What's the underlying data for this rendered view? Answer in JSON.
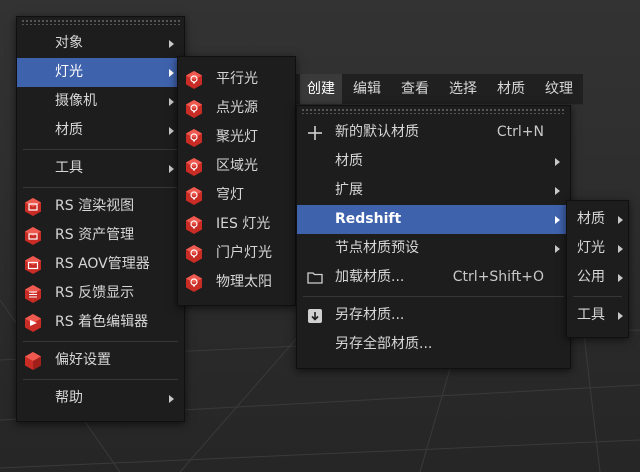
{
  "menubar": {
    "items": [
      "创建",
      "编辑",
      "查看",
      "选择",
      "材质",
      "纹理"
    ]
  },
  "main_menu": {
    "items": [
      {
        "label": "对象",
        "submenu": true
      },
      {
        "label": "灯光",
        "submenu": true,
        "highlighted": true
      },
      {
        "label": "摄像机",
        "submenu": true
      },
      {
        "label": "材质",
        "submenu": true
      },
      {
        "label": "工具",
        "submenu": true
      },
      {
        "label": "RS 渲染视图",
        "icon": "rs-renderview-icon"
      },
      {
        "label": "RS 资产管理",
        "icon": "rs-asset-icon"
      },
      {
        "label": "RS AOV管理器",
        "icon": "rs-aov-icon"
      },
      {
        "label": "RS 反馈显示",
        "icon": "rs-feedback-icon"
      },
      {
        "label": "RS 着色编辑器",
        "icon": "rs-shader-icon"
      },
      {
        "label": "偏好设置",
        "icon": "rs-prefs-icon"
      },
      {
        "label": "帮助",
        "submenu": true
      }
    ]
  },
  "lights_menu": {
    "items": [
      "平行光",
      "点光源",
      "聚光灯",
      "区域光",
      "穹灯",
      "IES 灯光",
      "门户灯光",
      "物理太阳"
    ]
  },
  "create_menu": {
    "items": [
      {
        "label": "新的默认材质",
        "shortcut": "Ctrl+N",
        "icon": "plus-icon"
      },
      {
        "label": "材质",
        "submenu": true
      },
      {
        "label": "扩展",
        "submenu": true
      },
      {
        "label": "Redshift",
        "submenu": true,
        "highlighted": true
      },
      {
        "label": "节点材质预设",
        "submenu": true
      },
      {
        "label": "加载材质...",
        "shortcut": "Ctrl+Shift+O",
        "icon": "folder-icon"
      },
      {
        "label": "另存材质...",
        "icon": "save-down-icon"
      },
      {
        "label": "另存全部材质..."
      }
    ]
  },
  "redshift_menu": {
    "items": [
      "材质",
      "灯光",
      "公用",
      "工具"
    ]
  },
  "colors": {
    "highlight": "#3f62ad",
    "menu_bg": "#1d1d1d",
    "rs_red": "#d9332b"
  }
}
